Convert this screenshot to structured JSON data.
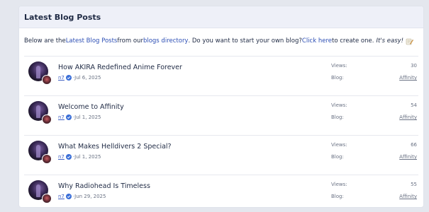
{
  "panel": {
    "title": "Latest Blog Posts"
  },
  "intro": {
    "text1": "Below are the ",
    "link1": "Latest Blog Posts",
    "text2": " from our ",
    "link2": "blogs directory",
    "text3": ". Do you want to start your own blog? ",
    "link3": "Click here",
    "text4": " to create one.",
    "emphasis": "It's easy!",
    "emoji_icon": "writing-hand-icon"
  },
  "labels": {
    "views": "Views:",
    "blog": "Blog:",
    "separator": " · "
  },
  "posts": [
    {
      "title": "How AKIRA Redefined Anime Forever",
      "author": "n7",
      "date": "Jul 6, 2025",
      "views": "30",
      "blog": "Affinity"
    },
    {
      "title": "Welcome to Affinity",
      "author": "n7",
      "date": "Jul 1, 2025",
      "views": "54",
      "blog": "Affinity"
    },
    {
      "title": "What Makes Helldivers 2 Special?",
      "author": "n7",
      "date": "Jul 1, 2025",
      "views": "66",
      "blog": "Affinity"
    },
    {
      "title": "Why Radiohead Is Timeless",
      "author": "n7",
      "date": "Jun 29, 2025",
      "views": "55",
      "blog": "Affinity"
    }
  ],
  "colors": {
    "accent": "#2d4fb5",
    "verified": "#3b6fd8"
  }
}
